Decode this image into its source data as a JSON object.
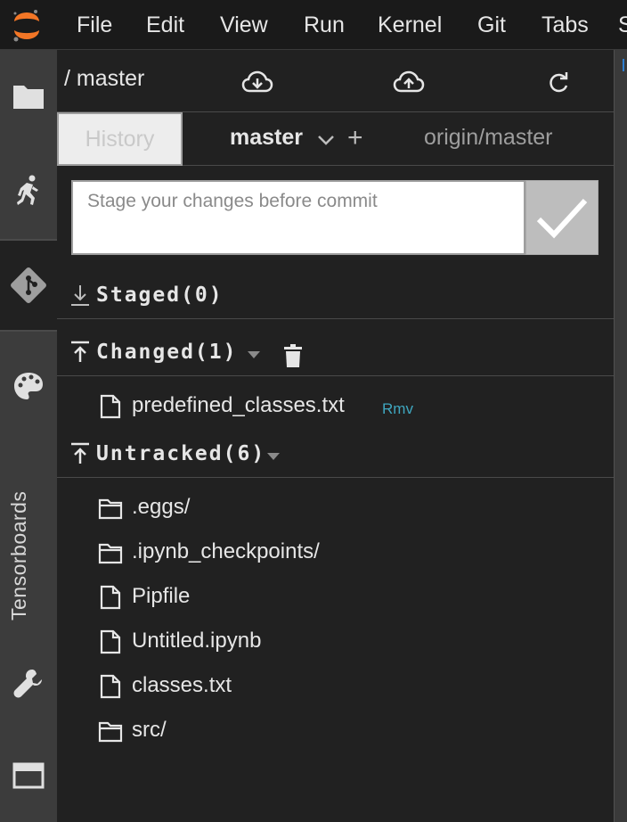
{
  "menubar": {
    "items": [
      "File",
      "Edit",
      "View",
      "Run",
      "Kernel",
      "Git",
      "Tabs",
      "S"
    ]
  },
  "sidebar": {
    "tensorboards_label": "Tensorboards",
    "icons": [
      "folder-icon",
      "running-icon",
      "git-icon",
      "palette-icon",
      "wrench-icon",
      "tab-icon"
    ],
    "active": "git-icon"
  },
  "git": {
    "repo_path": "/ master",
    "toolbar": [
      "pull-icon",
      "push-icon",
      "refresh-icon"
    ],
    "history_tab": "History",
    "current_branch": "master",
    "add_branch": "+",
    "remote_branch": "origin/master",
    "commit_placeholder": "Stage your changes before commit",
    "staged": {
      "title": "Staged(0)",
      "files": []
    },
    "changed": {
      "title": "Changed(1)",
      "files": [
        {
          "name": "predefined_classes.txt",
          "status": "Rmv",
          "type": "file"
        }
      ]
    },
    "untracked": {
      "title": "Untracked(6)",
      "files": [
        {
          "name": ".eggs/",
          "type": "folder"
        },
        {
          "name": ".ipynb_checkpoints/",
          "type": "folder"
        },
        {
          "name": "Pipfile",
          "type": "file"
        },
        {
          "name": "Untitled.ipynb",
          "type": "file"
        },
        {
          "name": "classes.txt",
          "type": "file"
        },
        {
          "name": "src/",
          "type": "folder"
        }
      ]
    }
  },
  "colors": {
    "menubar_bg": "#1a1a1a",
    "panel_bg": "#212121",
    "activity_bg": "#3c3c3c",
    "accent_logo": "#f37626",
    "status_link": "#3fa7c0"
  }
}
